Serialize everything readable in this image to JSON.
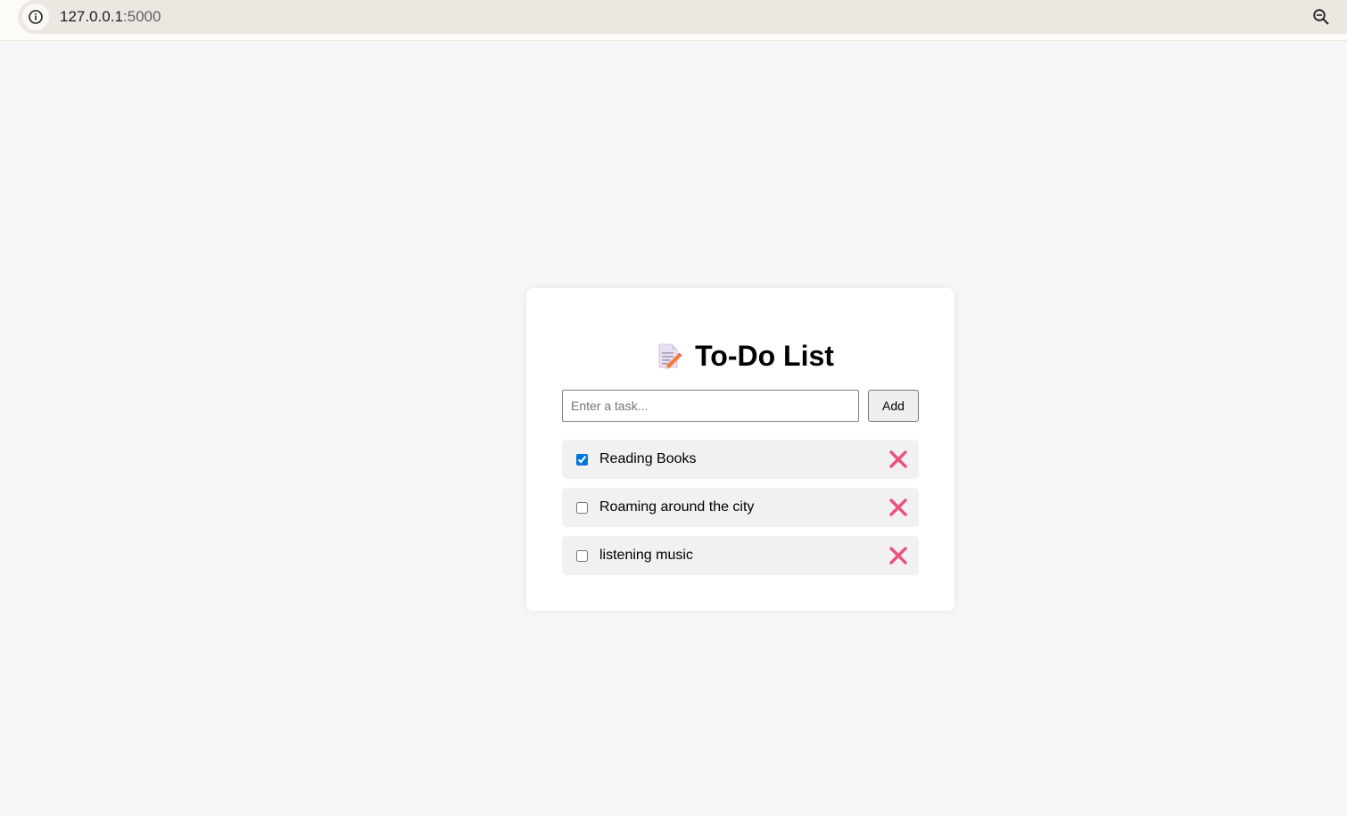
{
  "browser": {
    "url_host": "127.0.0.1",
    "url_port": ":5000",
    "info_icon": "info-icon",
    "zoom_icon": "zoom-out-icon"
  },
  "app": {
    "title": "To-Do List",
    "title_icon": "memo-icon",
    "input_placeholder": "Enter a task...",
    "input_value": "",
    "add_label": "Add",
    "tasks": [
      {
        "label": "Reading Books",
        "checked": true
      },
      {
        "label": "Roaming around the city",
        "checked": false
      },
      {
        "label": "listening music",
        "checked": false
      }
    ],
    "delete_icon": "close-icon"
  },
  "colors": {
    "page_bg": "#f7f7f7",
    "card_bg": "#ffffff",
    "task_bg": "#f1f1f1",
    "delete_color": "#ee4f7d",
    "checkbox_accent": "#0075d9"
  }
}
